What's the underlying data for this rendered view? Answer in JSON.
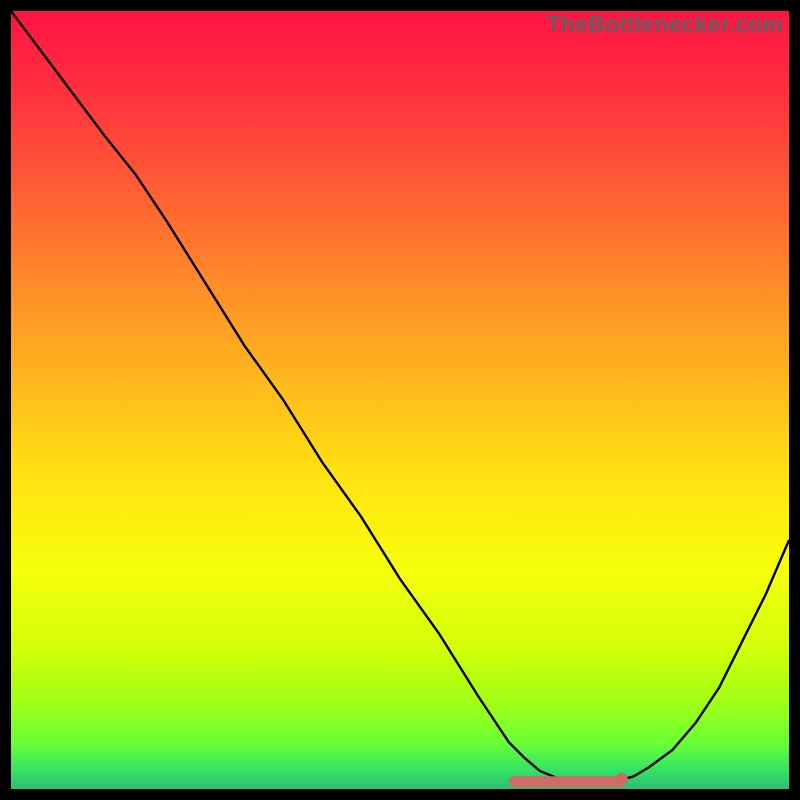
{
  "watermark": {
    "text": "TheBottlenecker.com"
  },
  "chart_data": {
    "type": "line",
    "title": "",
    "xlabel": "",
    "ylabel": "",
    "xlim": [
      0,
      100
    ],
    "ylim": [
      0,
      100
    ],
    "background_gradient": {
      "stops": [
        {
          "offset": 0.0,
          "color": "#ff1345"
        },
        {
          "offset": 0.1,
          "color": "#ff2f3f"
        },
        {
          "offset": 0.22,
          "color": "#ff5a35"
        },
        {
          "offset": 0.35,
          "color": "#ff8b29"
        },
        {
          "offset": 0.48,
          "color": "#ffb91d"
        },
        {
          "offset": 0.6,
          "color": "#ffe312"
        },
        {
          "offset": 0.72,
          "color": "#f6ff0a"
        },
        {
          "offset": 0.82,
          "color": "#d1ff09"
        },
        {
          "offset": 0.89,
          "color": "#a0ff15"
        },
        {
          "offset": 0.94,
          "color": "#6bff35"
        },
        {
          "offset": 0.975,
          "color": "#34e463"
        },
        {
          "offset": 1.0,
          "color": "#2fbe75"
        }
      ]
    },
    "series": [
      {
        "name": "bottleneck-curve",
        "color": "#000000",
        "x": [
          0,
          3,
          6,
          9,
          12,
          16,
          20,
          25,
          30,
          35,
          40,
          45,
          50,
          55,
          60,
          62,
          64,
          66,
          68,
          70,
          72,
          74,
          76,
          78,
          80,
          82,
          85,
          88,
          91,
          94,
          97,
          100
        ],
        "y": [
          100,
          96,
          92,
          88,
          84,
          79,
          73,
          65,
          57,
          50,
          42,
          35,
          27,
          20,
          12,
          9,
          6,
          4,
          2.3,
          1.5,
          1.1,
          1.0,
          1.0,
          1.1,
          1.6,
          2.8,
          5,
          8.5,
          13,
          19,
          25,
          32
        ]
      },
      {
        "name": "optimal-zone-badge",
        "color": "#cf6a66",
        "type": "marker-band",
        "x_start": 64,
        "x_end": 79,
        "y": 1.0,
        "y_dot": 1.3,
        "x_dot": 78.5
      }
    ]
  }
}
